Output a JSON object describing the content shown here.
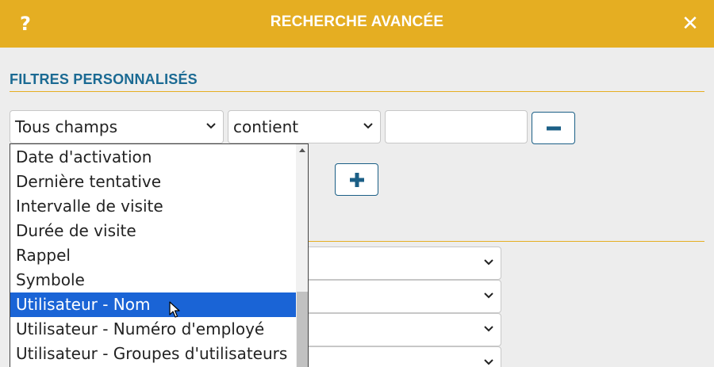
{
  "dialog": {
    "title": "RECHERCHE AVANCÉE",
    "help_label": "?",
    "close_label": "✕"
  },
  "filters": {
    "section_title": "FILTRES PERSONNALISÉS",
    "field_select": "Tous champs",
    "operator_select": "contient",
    "value_input": "",
    "remove_icon": "minus-icon",
    "add_icon": "plus-icon"
  },
  "dropdown": {
    "options": [
      "Date d'activation",
      "Dernière tentative",
      "Intervalle de visite",
      "Durée de visite",
      "Rappel",
      "Symbole",
      "Utilisateur - Nom",
      "Utilisateur - Numéro d'employé",
      "Utilisateur - Groupes d'utilisateurs"
    ],
    "selected_option": "Utilisateur - Nom"
  },
  "second_section": {
    "selects": [
      "",
      "",
      "",
      ""
    ]
  },
  "colors": {
    "header": "#e5ae22",
    "section_title": "#1b6a93",
    "selected_option": "#1a64d6",
    "button_border": "#1b5f86"
  }
}
